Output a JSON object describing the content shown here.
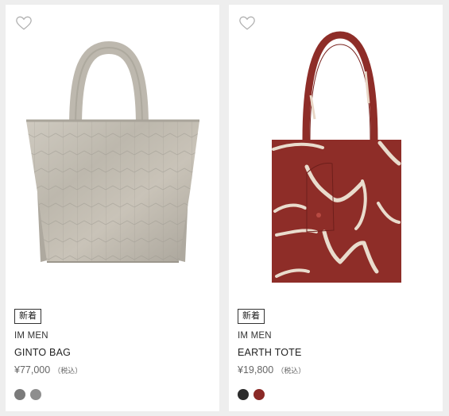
{
  "products": [
    {
      "badge": "新着",
      "brand": "IM MEN",
      "name": "GINTO BAG",
      "price": "¥77,000",
      "tax_note": "（税込）",
      "image_icon": "quilted-silver-tote-bag",
      "swatches": [
        "#7b7b7b",
        "#8e8e8e"
      ]
    },
    {
      "badge": "新着",
      "brand": "IM MEN",
      "name": "EARTH TOTE",
      "price": "¥19,800",
      "tax_note": "（税込）",
      "image_icon": "printed-red-tote-bag",
      "swatches": [
        "#2b2b2b",
        "#8b2a27"
      ]
    }
  ]
}
